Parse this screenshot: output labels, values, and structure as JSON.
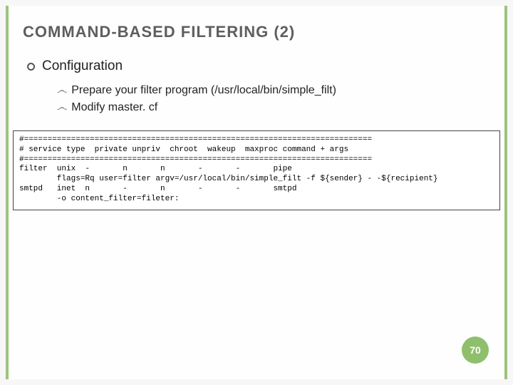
{
  "title_html": "C<span class='sm'>OMMAND</span>-B<span class='sm'>ASED</span> F<span class='sm'>ILTERING</span> (2)",
  "title_plain": "COMMAND-BASED FILTERING (2)",
  "section": "Configuration",
  "subitems": [
    "Prepare your filter program (/usr/local/bin/simple_filt)",
    "Modify master. cf"
  ],
  "code": "#==========================================================================\n# service type  private unpriv  chroot  wakeup  maxproc command + args\n#==========================================================================\nfilter  unix  -       n       n       -       -       pipe\n        flags=Rq user=filter argv=/usr/local/bin/simple_filt -f ${sender} - -${recipient}\nsmtpd   inet  n       -       n       -       -       smtpd\n        -o content_filter=fileter:",
  "page_number": "70"
}
